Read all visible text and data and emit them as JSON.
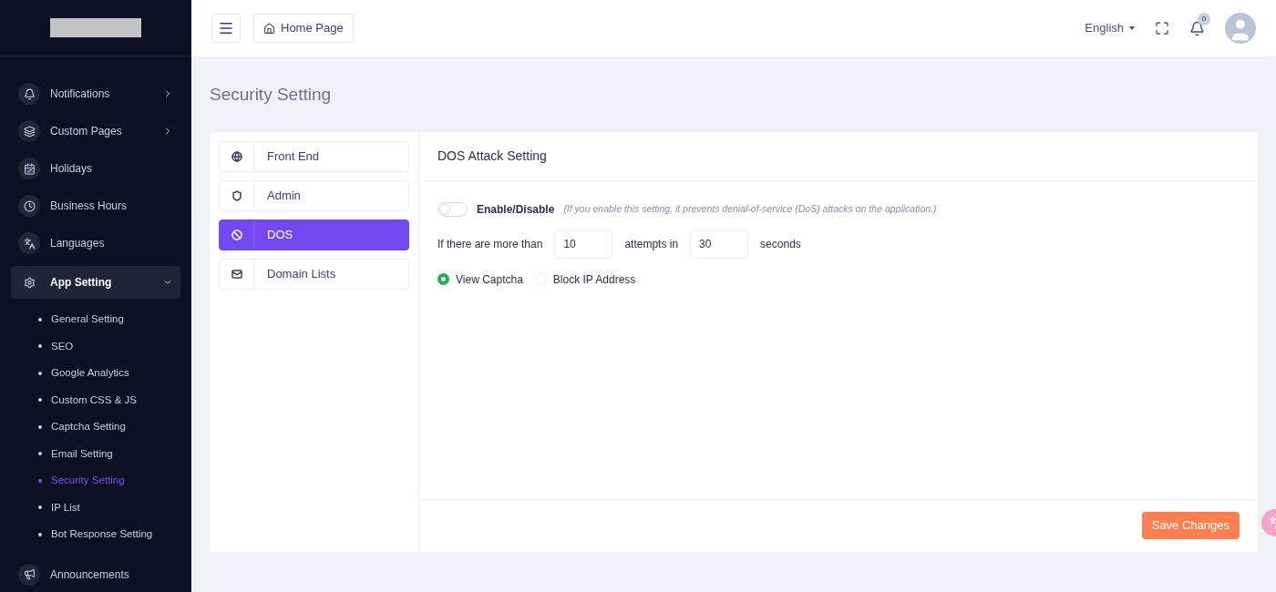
{
  "topbar": {
    "breadcrumb": "Home Page",
    "language": "English",
    "notification_count": "0"
  },
  "sidebar": {
    "items": [
      {
        "label": "Notifications",
        "has_arrow": true,
        "expanded": false
      },
      {
        "label": "Custom Pages",
        "has_arrow": true,
        "expanded": false
      },
      {
        "label": "Holidays",
        "has_arrow": false,
        "expanded": false
      },
      {
        "label": "Business Hours",
        "has_arrow": false,
        "expanded": false
      },
      {
        "label": "Languages",
        "has_arrow": false,
        "expanded": false
      },
      {
        "label": "App Setting",
        "has_arrow": true,
        "expanded": true,
        "children": [
          {
            "label": "General Setting",
            "selected": false
          },
          {
            "label": "SEO",
            "selected": false
          },
          {
            "label": "Google Analytics",
            "selected": false
          },
          {
            "label": "Custom CSS & JS",
            "selected": false
          },
          {
            "label": "Captcha Setting",
            "selected": false
          },
          {
            "label": "Email Setting",
            "selected": false
          },
          {
            "label": "Security Setting",
            "selected": true
          },
          {
            "label": "IP List",
            "selected": false
          },
          {
            "label": "Bot Response Setting",
            "selected": false
          }
        ]
      },
      {
        "label": "Announcements",
        "has_arrow": false,
        "expanded": false
      }
    ]
  },
  "page_title": "Security Setting",
  "tabs": [
    {
      "label": "Front End",
      "selected": false
    },
    {
      "label": "Admin",
      "selected": false
    },
    {
      "label": "DOS",
      "selected": true
    },
    {
      "label": "Domain Lists",
      "selected": false
    }
  ],
  "panel": {
    "title": "DOS Attack Setting",
    "toggle": {
      "label": "Enable/Disable",
      "on": false,
      "hint": "(If you enable this setting, it prevents denial-of-service (DoS) attacks on the application.)"
    },
    "rule": {
      "prefix": "If there are more than",
      "attempts": "10",
      "middle": "attempts in",
      "seconds": "30",
      "suffix": "seconds"
    },
    "options": [
      {
        "label": "View Captcha",
        "selected": true
      },
      {
        "label": "Block IP Address",
        "selected": false
      }
    ],
    "save_button": "Save Changes"
  }
}
